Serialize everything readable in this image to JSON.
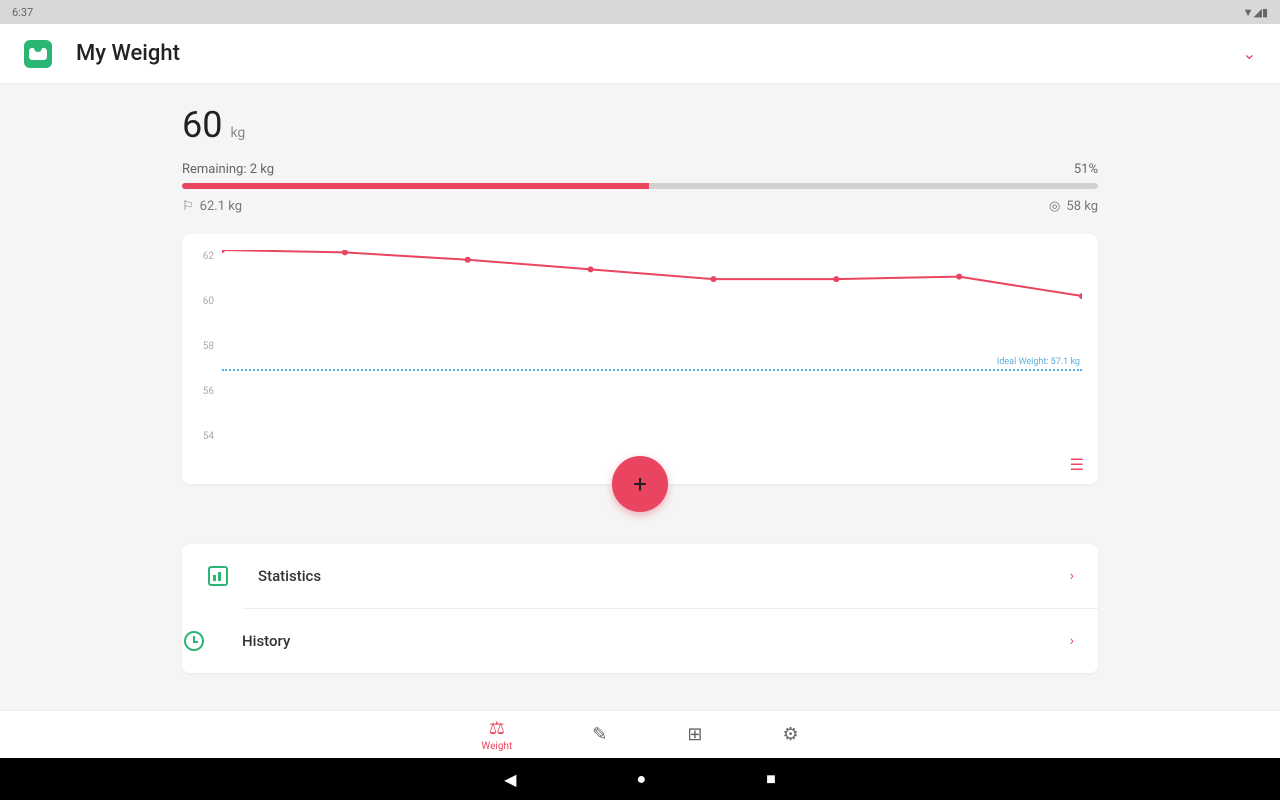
{
  "status": {
    "time": "6:37",
    "icons": "▼◢▮"
  },
  "header": {
    "title": "My Weight"
  },
  "weight": {
    "value": "60",
    "unit": "kg"
  },
  "progress": {
    "remaining_label": "Remaining: 2 kg",
    "percent_label": "51%",
    "fill_pct": 51
  },
  "flags": {
    "start": "62.1 kg",
    "target": "58 kg"
  },
  "chart_data": {
    "type": "line",
    "x": [
      0,
      1,
      2,
      3,
      4,
      5,
      6,
      7
    ],
    "values": [
      62,
      61.9,
      61.6,
      61.2,
      60.8,
      60.8,
      60.9,
      60.1
    ],
    "ylabel": "",
    "xlabel": "",
    "ylim": [
      54,
      62
    ],
    "y_ticks": [
      62,
      60,
      58,
      56,
      54
    ],
    "ideal": {
      "value": 57.1,
      "label": "Ideal Weight: 57.1 kg"
    }
  },
  "list": {
    "statistics": "Statistics",
    "history": "History"
  },
  "nav": {
    "weight": "Weight"
  },
  "colors": {
    "accent": "#e94560",
    "green": "#2bb673",
    "blue": "#5ab0e0"
  }
}
